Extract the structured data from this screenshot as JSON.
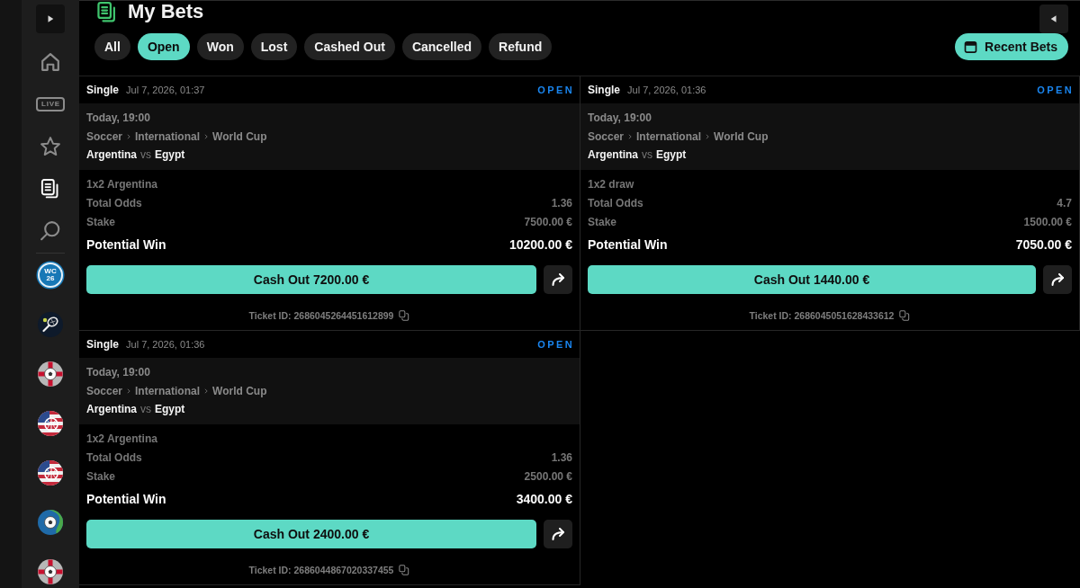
{
  "sidebar": {
    "nav": [
      {
        "kind": "home",
        "selected": false
      },
      {
        "kind": "live",
        "label": "LIVE",
        "selected": false
      },
      {
        "kind": "favorites",
        "selected": false
      },
      {
        "kind": "bets",
        "selected": true
      },
      {
        "kind": "search",
        "selected": false
      }
    ],
    "sports": [
      {
        "kind": "tournament",
        "label": "WC 26"
      },
      {
        "kind": "tennis"
      },
      {
        "kind": "soccer-cross"
      },
      {
        "kind": "basketball-stripes"
      },
      {
        "kind": "basketball-stripes"
      },
      {
        "kind": "soccer-globe"
      },
      {
        "kind": "soccer-cross"
      }
    ]
  },
  "header": {
    "title": "My Bets"
  },
  "filters": [
    {
      "label": "All",
      "selected": false
    },
    {
      "label": "Open",
      "selected": true
    },
    {
      "label": "Won",
      "selected": false
    },
    {
      "label": "Lost",
      "selected": false
    },
    {
      "label": "Cashed Out",
      "selected": false
    },
    {
      "label": "Cancelled",
      "selected": false
    },
    {
      "label": "Refund",
      "selected": false
    }
  ],
  "recent_bets": {
    "label": "Recent Bets"
  },
  "bets": [
    {
      "type": "Single",
      "placed": "Jul 7, 2026, 01:37",
      "status": "OPEN",
      "event_time": "Today, 19:00",
      "path": [
        "Soccer",
        "International",
        "World Cup"
      ],
      "home": "Argentina",
      "vs": "vs",
      "away": "Egypt",
      "selection": "1x2 Argentina",
      "odds_label": "Total Odds",
      "odds": "1.36",
      "stake_label": "Stake",
      "stake": "7500.00 €",
      "win_label": "Potential Win",
      "win": "10200.00 €",
      "cash_out": "Cash Out 7200.00 €",
      "ticket": "Ticket ID: 2686045264451612899"
    },
    {
      "type": "Single",
      "placed": "Jul 7, 2026, 01:36",
      "status": "OPEN",
      "event_time": "Today, 19:00",
      "path": [
        "Soccer",
        "International",
        "World Cup"
      ],
      "home": "Argentina",
      "vs": "vs",
      "away": "Egypt",
      "selection": "1x2 draw",
      "odds_label": "Total Odds",
      "odds": "4.7",
      "stake_label": "Stake",
      "stake": "1500.00 €",
      "win_label": "Potential Win",
      "win": "7050.00 €",
      "cash_out": "Cash Out 1440.00 €",
      "ticket": "Ticket ID: 2686045051628433612"
    },
    {
      "type": "Single",
      "placed": "Jul 7, 2026, 01:36",
      "status": "OPEN",
      "event_time": "Today, 19:00",
      "path": [
        "Soccer",
        "International",
        "World Cup"
      ],
      "home": "Argentina",
      "vs": "vs",
      "away": "Egypt",
      "selection": "1x2 Argentina",
      "odds_label": "Total Odds",
      "odds": "1.36",
      "stake_label": "Stake",
      "stake": "2500.00 €",
      "win_label": "Potential Win",
      "win": "3400.00 €",
      "cash_out": "Cash Out 2400.00 €",
      "ticket": "Ticket ID: 2686044867020337455"
    }
  ]
}
